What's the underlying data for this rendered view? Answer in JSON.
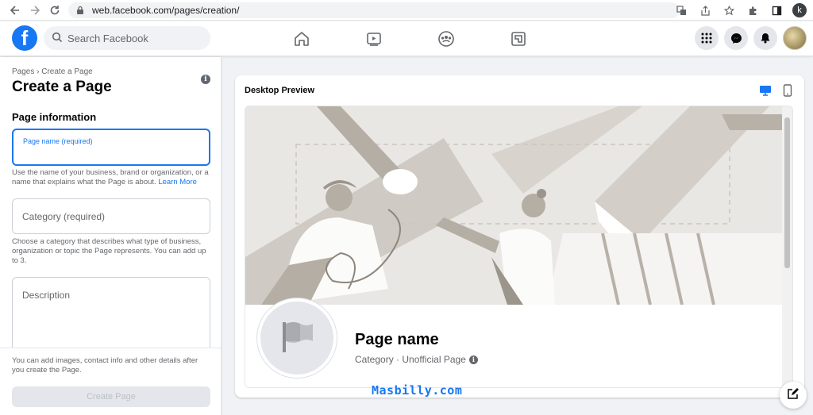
{
  "browser": {
    "url": "web.facebook.com/pages/creation/",
    "profile_initial": "k"
  },
  "topbar": {
    "logo_letter": "f",
    "search_placeholder": "Search Facebook"
  },
  "left_panel": {
    "breadcrumb": "Pages › Create a Page",
    "title": "Create a Page",
    "section_heading": "Page information",
    "page_name_label": "Page name (required)",
    "page_name_help": "Use the name of your business, brand or organization, or a name that explains what the Page is about.",
    "learn_more": "Learn More",
    "category_placeholder": "Category (required)",
    "category_help": "Choose a category that describes what type of business, organization or topic the Page represents. You can add up to 3.",
    "description_placeholder": "Description",
    "footer_text": "You can add images, contact info and other details after you create the Page.",
    "create_button": "Create Page"
  },
  "preview": {
    "label": "Desktop Preview",
    "page_name": "Page name",
    "page_category": "Category · Unofficial Page"
  },
  "watermark": "Masbilly.com",
  "colors": {
    "brand_blue": "#1877f2",
    "background": "#f0f2f5",
    "cover_bg": "#e9e7e3"
  }
}
